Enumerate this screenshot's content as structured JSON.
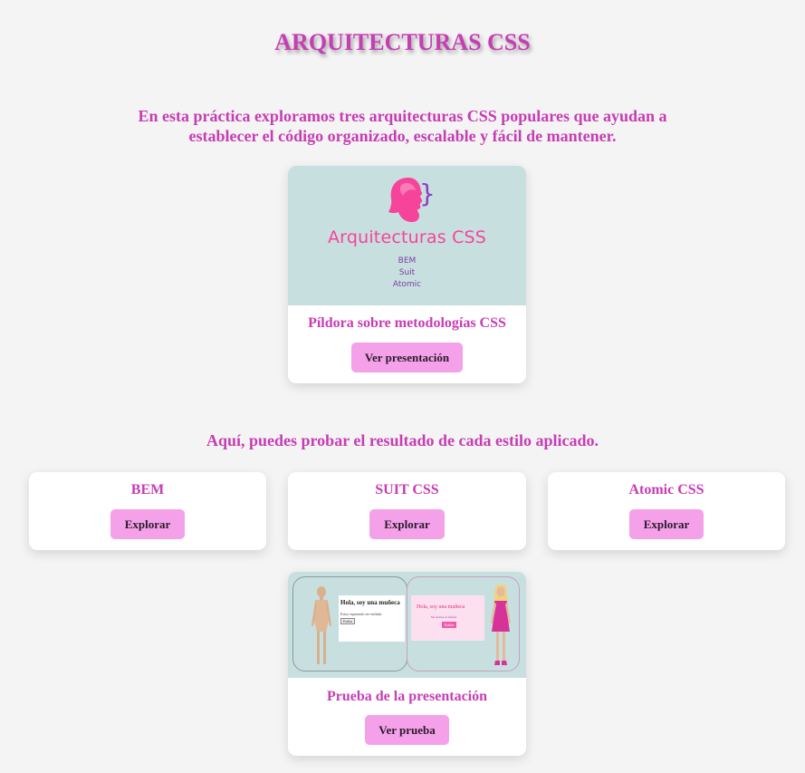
{
  "page": {
    "title": "ARQUITECTURAS CSS",
    "intro": "En esta práctica exploramos tres arquitecturas CSS populares que ayudan a establecer el código organizado, escalable y fácil de mantener.",
    "subheading": "Aquí, puedes probar el resultado de cada estilo aplicado."
  },
  "presentation_card": {
    "image": {
      "icon": "woman-head-profile-icon",
      "brace": "}",
      "title": "Arquitecturas CSS",
      "items": [
        "BEM",
        "Suit",
        "Atomic"
      ]
    },
    "caption": "Píldora sobre metodologías CSS",
    "button_label": "Ver presentación"
  },
  "styles": [
    {
      "name": "BEM",
      "button_label": "Explorar"
    },
    {
      "name": "SUIT CSS",
      "button_label": "Explorar"
    },
    {
      "name": "Atomic CSS",
      "button_label": "Explorar"
    }
  ],
  "test_card": {
    "image": {
      "left_panel": {
        "heading": "Hola, soy una muñeca",
        "text": "Estoy esperando ser estilada.",
        "button": "Estilar"
      },
      "right_panel": {
        "heading": "Hola, soy una muñeca",
        "text": "Me encanta ser estilada.",
        "button": "Estilar"
      }
    },
    "caption": "Prueba de la presentación",
    "button_label": "Ver prueba"
  },
  "colors": {
    "accent": "#c63db4",
    "button": "#f4a1ea",
    "background": "#f4f4f4",
    "image_bg": "#c8dfe0",
    "logo_pink": "#f5449a"
  }
}
